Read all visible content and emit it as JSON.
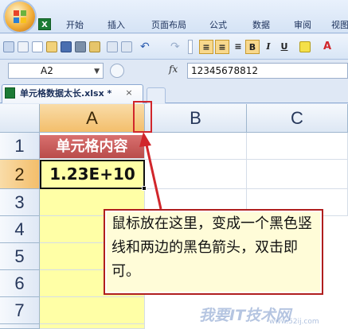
{
  "ribbon": {
    "tabs": [
      "开始",
      "插入",
      "页面布局",
      "公式",
      "数据",
      "审阅",
      "视图"
    ],
    "excel_icon": "X"
  },
  "toolbar": {
    "bold": "B",
    "italic": "I",
    "underline": "U",
    "font_color_letter": "A",
    "accent": "#d1262b"
  },
  "formula_bar": {
    "name_box": "A2",
    "fx": "fx",
    "value": "12345678812"
  },
  "document": {
    "tab_title": "单元格数据太长.xlsx *",
    "close": "×"
  },
  "sheet": {
    "columns": [
      "A",
      "B",
      "C"
    ],
    "rows": [
      "1",
      "2",
      "3",
      "4",
      "5",
      "6",
      "7"
    ],
    "cells": {
      "A1": "单元格内容",
      "A2": "1.23E+10"
    }
  },
  "annotation": {
    "text": "鼠标放在这里，变成一个黑色竖线和两边的黑色箭头，双击即可。",
    "color": "#d1262b"
  },
  "watermark": {
    "main": "我要IT技术网",
    "sub": "www.52ij.com"
  }
}
